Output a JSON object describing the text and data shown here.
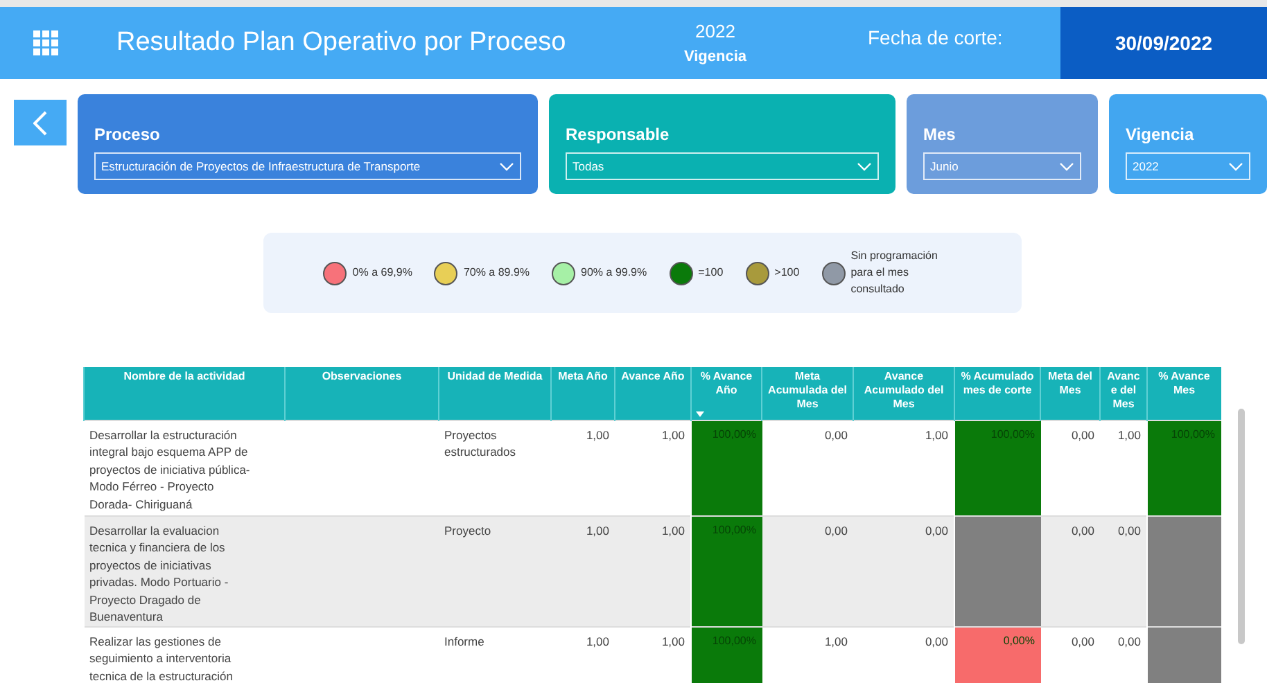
{
  "header": {
    "title": "Resultado Plan Operativo por Proceso",
    "year": "2022",
    "year_label": "Vigencia",
    "cutoff_label": "Fecha de corte:",
    "cutoff_date": "30/09/2022"
  },
  "filters": [
    {
      "label": "Proceso",
      "value": "Estructuración de Proyectos de Infraestructura de Transporte",
      "color": "#3a82dc"
    },
    {
      "label": "Responsable",
      "value": "Todas",
      "color": "#0ab1b1"
    },
    {
      "label": "Mes",
      "value": "Junio",
      "color": "#6c9ddc"
    },
    {
      "label": "Vigencia",
      "value": "2022",
      "color": "#42a6f0"
    }
  ],
  "legend": [
    {
      "label": "0% a 69,9%",
      "color": "#f7727a"
    },
    {
      "label": "70% a 89.9%",
      "color": "#e8cf56"
    },
    {
      "label": "90% a 99.9%",
      "color": "#a6f0a6"
    },
    {
      "label": "=100",
      "color": "#0a7a0a"
    },
    {
      "label": ">100",
      "color": "#a89a3c"
    },
    {
      "label": "Sin programación para el mes consultado",
      "color": "#9099a6"
    }
  ],
  "table": {
    "columns": [
      {
        "label": "Nombre de la actividad",
        "sorted": false
      },
      {
        "label": "Observaciones",
        "sorted": false
      },
      {
        "label": "Unidad de Medida",
        "sorted": false
      },
      {
        "label": "Meta Año",
        "sorted": false
      },
      {
        "label": "Avance Año",
        "sorted": false
      },
      {
        "label": "% Avance Año",
        "sorted": true
      },
      {
        "label": "Meta Acumulada del Mes",
        "sorted": false
      },
      {
        "label": "Avance Acumulado del Mes",
        "sorted": false
      },
      {
        "label": "% Acumulado mes de corte",
        "sorted": false
      },
      {
        "label": "Meta del Mes",
        "sorted": false
      },
      {
        "label": "Avanc e del Mes",
        "sorted": false
      },
      {
        "label": "% Avance Mes",
        "sorted": false
      }
    ],
    "rows": [
      {
        "actividad": "Desarrollar la estructuración integral bajo esquema APP de proyectos de iniciativa pública- Modo Férreo - Proyecto Dorada- Chiriguaná",
        "unidad": "Proyectos estructurados",
        "meta_anio": "1,00",
        "avance_anio": "1,00",
        "pct_avance_anio": {
          "text": "100,00%",
          "color": "#0a7a0a"
        },
        "meta_acumulada": "0,00",
        "avance_acumulado": "1,00",
        "pct_acumulado": {
          "text": "100,00%",
          "color": "#0a7a0a"
        },
        "meta_mes": "0,00",
        "avance_mes": "1,00",
        "pct_avance_mes": {
          "text": "100,00%",
          "color": "#0a7a0a"
        }
      },
      {
        "actividad": "Desarrollar la evaluacion tecnica y financiera de los proyectos de iniciativas privadas. Modo Portuario - Proyecto Dragado de Buenaventura",
        "unidad": "Proyecto",
        "meta_anio": "1,00",
        "avance_anio": "1,00",
        "pct_avance_anio": {
          "text": "100,00%",
          "color": "#0a7a0a"
        },
        "meta_acumulada": "0,00",
        "avance_acumulado": "0,00",
        "pct_acumulado": {
          "color": "#808080"
        },
        "meta_mes": "0,00",
        "avance_mes": "0,00",
        "pct_avance_mes": {
          "color": "#808080"
        }
      },
      {
        "actividad": "Realizar las gestiones de seguimiento a interventoria tecnica de la estructuración",
        "unidad": "Informe",
        "meta_anio": "1,00",
        "avance_anio": "1,00",
        "pct_avance_anio": {
          "text": "100,00%",
          "color": "#0a7a0a"
        },
        "meta_acumulada": "1,00",
        "avance_acumulado": "0,00",
        "pct_acumulado": {
          "text": "0,00%",
          "color": "#f76b6b"
        },
        "meta_mes": "0,00",
        "avance_mes": "0,00",
        "pct_avance_mes": {
          "color": "#808080"
        }
      }
    ]
  }
}
